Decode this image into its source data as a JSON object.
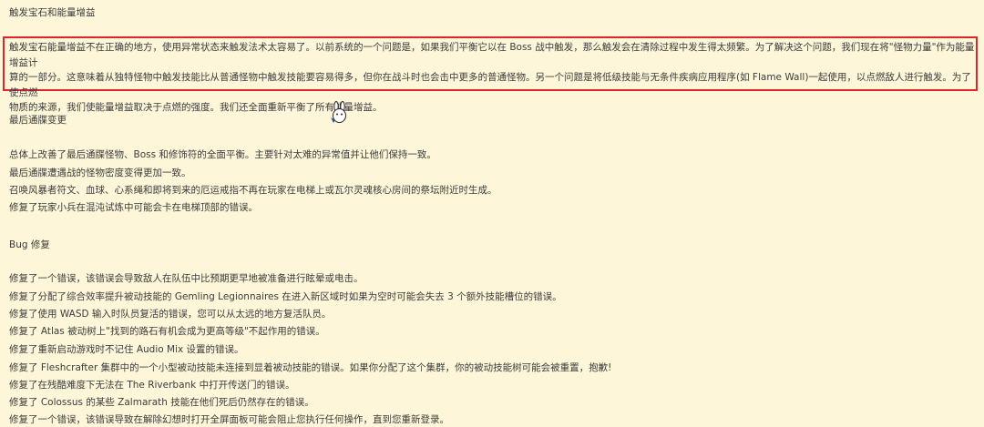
{
  "section1": {
    "title": "触发宝石和能量增益",
    "highlighted_paragraph": [
      "触发宝石能量增益不在正确的地方，使用异常状态来触发法术太容易了。以前系统的一个问题是，如果我们平衡它以在 Boss 战中触发，那么触发会在清除过程中发生得太频繁。为了解决这个问题，我们现在将\"怪物力量\"作为能量增益计",
      "算的一部分。这意味着从独特怪物中触发技能比从普通怪物中触发技能要容易得多，但你在战斗时也会击中更多的普通怪物。另一个问题是将低级技能与无条件疾病应用程序(如 Flame Wall)一起使用，以点燃敌人进行触发。为了使点燃",
      "物质的来源，我们使能量增益取决于点燃的强度。我们还全面重新平衡了所有能量增益。"
    ]
  },
  "section2": {
    "title": "最后通牒变更",
    "items": [
      "总体上改善了最后通牒怪物、Boss 和修饰符的全面平衡。主要针对太难的异常值并让他们保持一致。",
      "最后通牒遭遇战的怪物密度变得更加一致。",
      "召唤风暴者符文、血球、心系绳和即将到来的厄运戒指不再在玩家在电梯上或瓦尔灵魂核心房间的祭坛附近时生成。",
      "修复了玩家小兵在混沌试炼中可能会卡在电梯顶部的错误。"
    ]
  },
  "section3": {
    "title": "Bug 修复",
    "items": [
      "修复了一个错误，该错误会导致敌人在队伍中比预期更早地被准备进行眩晕或电击。",
      "修复了分配了综合效率提升被动技能的 Gemling Legionnaires 在进入新区域时如果为空时可能会失去 3 个额外技能槽位的错误。",
      "修复了使用 WASD 输入时队员复活的错误，您可以从太远的地方复活队员。",
      "修复了 Atlas 被动树上\"找到的路石有机会成为更高等级\"不起作用的错误。",
      "修复了重新启动游戏时不记住 Audio Mix 设置的错误。",
      "修复了 Fleshcrafter 集群中的一个小型被动技能未连接到显着被动技能的错误。如果你分配了这个集群，你的被动技能树可能会被重置，抱歉!",
      "修复了在残酷难度下无法在 The Riverbank 中打开传送门的错误。",
      "修复了 Colossus 的某些 Zalmarath 技能在他们死后仍然存在的错误。",
      "修复了一个错误，该错误导致在解除幻想时打开全屏面板可能会阻止您执行任何操作，直到您重新登录。"
    ]
  },
  "colors": {
    "background": "#fdf6d9",
    "highlight_border": "#e0242b",
    "text": "#3c3c3c"
  },
  "icons": {
    "cursor": "bunny-cursor-icon"
  }
}
